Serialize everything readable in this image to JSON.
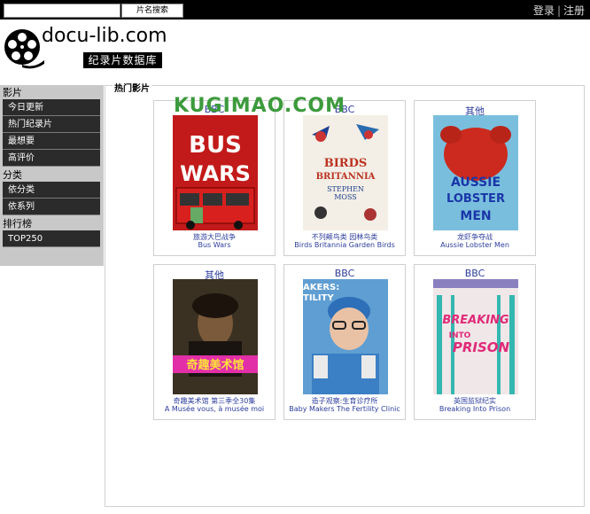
{
  "topbar": {
    "search_value": "",
    "search_button": "片名搜索",
    "login": "登录",
    "separator": "|",
    "register": "注册"
  },
  "logo": {
    "title": "docu-lib.com",
    "subtitle": "纪录片数据库"
  },
  "sidebar": {
    "section1": "影片",
    "items1": [
      "今日更新",
      "热门纪录片",
      "最想要",
      "高评价"
    ],
    "section2": "分类",
    "items2": [
      "依分类",
      "依系列"
    ],
    "section3": "排行榜",
    "items3": [
      "TOP250"
    ]
  },
  "main": {
    "title": "热门影片",
    "cards": [
      {
        "tag": "BBC",
        "cn": "旅游大巴战争",
        "en": "Bus Wars",
        "poster_text": "BUS WARS"
      },
      {
        "tag": "BBC",
        "cn": "不列颠鸟类 园林鸟类",
        "en": "Birds Britannia Garden Birds",
        "poster_text": "BIRDS BRITANNIA",
        "poster_author": "STEPHEN MOSS"
      },
      {
        "tag": "其他",
        "cn": "龙虾争夺战",
        "en": "Aussie Lobster Men",
        "poster_text": "AUSSIE LOBSTER MEN"
      },
      {
        "tag": "其他",
        "cn": "奇趣美术馆 第三季全30集",
        "en": "A Musée vous, à musée moi",
        "poster_text": "奇趣美术馆"
      },
      {
        "tag": "BBC",
        "cn": "造子观察:生育诊疗所",
        "en": "Baby Makers The Fertility Clinic",
        "poster_text": "AKERS: TILITY"
      },
      {
        "tag": "BBC",
        "cn": "英国监狱纪实",
        "en": "Breaking Into Prison",
        "poster_text": "BREAKING INTO PRISON"
      }
    ]
  },
  "watermark": "KUGIMAO.COM",
  "colors": {
    "link": "#2c3d9c",
    "sidebar_bg": "#c8c8c8",
    "sidebar_item": "#2b2b2b"
  }
}
